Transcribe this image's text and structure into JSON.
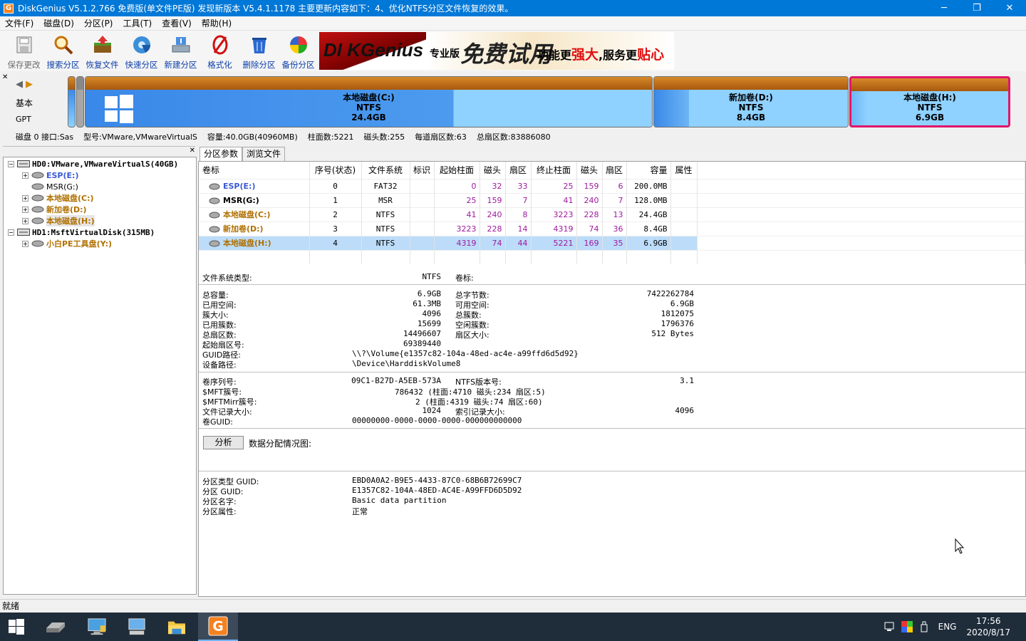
{
  "window": {
    "title": "DiskGenius V5.1.2.766 免费版(单文件PE版)   发现新版本 V5.4.1.1178 主要更新内容如下：4、优化NTFS分区文件恢复的效果。",
    "app_icon": "G",
    "min": "─",
    "max": "❐",
    "close": "✕"
  },
  "menu": [
    "文件(F)",
    "磁盘(D)",
    "分区(P)",
    "工具(T)",
    "查看(V)",
    "帮助(H)"
  ],
  "toolbar": [
    {
      "label": "保存更改",
      "icon": "save-icon",
      "disabled": true
    },
    {
      "label": "搜索分区",
      "icon": "search-icon"
    },
    {
      "label": "恢复文件",
      "icon": "recover-icon"
    },
    {
      "label": "快速分区",
      "icon": "quick-partition-icon"
    },
    {
      "label": "新建分区",
      "icon": "new-partition-icon"
    },
    {
      "label": "格式化",
      "icon": "format-icon"
    },
    {
      "label": "删除分区",
      "icon": "delete-icon"
    },
    {
      "label": "备份分区",
      "icon": "backup-icon"
    }
  ],
  "banner": {
    "brand": "DI KGenius",
    "edition": "专业版",
    "free": "免费试用",
    "slogan1": "功能更",
    "slogan2": "强大",
    "slogan3": ",服务更",
    "slogan4": "贴心"
  },
  "disk_nav": {
    "type1": "基本",
    "type2": "GPT"
  },
  "disk_segments": [
    {
      "name": "本地磁盘(C:)",
      "fs": "NTFS",
      "size": "24.4GB"
    },
    {
      "name": "新加卷(D:)",
      "fs": "NTFS",
      "size": "8.4GB"
    },
    {
      "name": "本地磁盘(H:)",
      "fs": "NTFS",
      "size": "6.9GB"
    }
  ],
  "disk_info": [
    "磁盘 0 接口:Sas",
    "型号:VMware,VMwareVirtualS",
    "容量:40.0GB(40960MB)",
    "柱面数:5221",
    "磁头数:255",
    "每道扇区数:63",
    "总扇区数:83886080"
  ],
  "tree": {
    "disk0": "HD0:VMware,VMwareVirtualS(40GB)",
    "disk0_parts": [
      "ESP(E:)",
      "MSR(G:)",
      "本地磁盘(C:)",
      "新加卷(D:)",
      "本地磁盘(H:)"
    ],
    "disk1": "HD1:MsftVirtualDisk(315MB)",
    "disk1_parts": [
      "小白PE工具盘(Y:)"
    ]
  },
  "tabs": [
    "分区参数",
    "浏览文件"
  ],
  "table": {
    "headers": [
      "卷标",
      "序号(状态)",
      "文件系统",
      "标识",
      "起始柱面",
      "磁头",
      "扇区",
      "终止柱面",
      "磁头",
      "扇区",
      "容量",
      "属性"
    ],
    "rows": [
      [
        "ESP(E:)",
        "0",
        "FAT32",
        "",
        "0",
        "32",
        "33",
        "25",
        "159",
        "6",
        "200.0MB",
        ""
      ],
      [
        "MSR(G:)",
        "1",
        "MSR",
        "",
        "25",
        "159",
        "7",
        "41",
        "240",
        "7",
        "128.0MB",
        ""
      ],
      [
        "本地磁盘(C:)",
        "2",
        "NTFS",
        "",
        "41",
        "240",
        "8",
        "3223",
        "228",
        "13",
        "24.4GB",
        ""
      ],
      [
        "新加卷(D:)",
        "3",
        "NTFS",
        "",
        "3223",
        "228",
        "14",
        "4319",
        "74",
        "36",
        "8.4GB",
        ""
      ],
      [
        "本地磁盘(H:)",
        "4",
        "NTFS",
        "",
        "4319",
        "74",
        "44",
        "5221",
        "169",
        "35",
        "6.9GB",
        ""
      ]
    ]
  },
  "fs_info": {
    "fs_type_label": "文件系统类型:",
    "fs_type": "NTFS",
    "vol_label_label": "卷标:",
    "left": [
      [
        "总容量:",
        "6.9GB"
      ],
      [
        "已用空间:",
        "61.3MB"
      ],
      [
        "簇大小:",
        "4096"
      ],
      [
        "已用簇数:",
        "15699"
      ],
      [
        "总扇区数:",
        "14496607"
      ],
      [
        "起始扇区号:",
        "69389440"
      ]
    ],
    "right": [
      [
        "总字节数:",
        "7422262784"
      ],
      [
        "可用空间:",
        "6.9GB"
      ],
      [
        "总簇数:",
        "1812075"
      ],
      [
        "空闲簇数:",
        "1796376"
      ],
      [
        "扇区大小:",
        "512 Bytes"
      ]
    ],
    "guid_path_label": "GUID路径:",
    "guid_path": "\\\\?\\Volume{e1357c82-104a-48ed-ac4e-a99ffd6d5d92}",
    "device_path_label": "设备路径:",
    "device_path": "\\Device\\HarddiskVolume8",
    "serial_label": "卷序列号:",
    "serial": "09C1-B27D-A5EB-573A",
    "ntfs_ver_label": "NTFS版本号:",
    "ntfs_ver": "3.1",
    "mft_label": "$MFT簇号:",
    "mft": "786432 (柱面:4710 磁头:234 扇区:5)",
    "mftmirr_label": "$MFTMirr簇号:",
    "mftmirr": "2 (柱面:4319 磁头:74 扇区:60)",
    "rec_size_label": "文件记录大小:",
    "rec_size": "1024",
    "idx_size_label": "索引记录大小:",
    "idx_size": "4096",
    "vol_guid_label": "卷GUID:",
    "vol_guid": "00000000-0000-0000-0000-000000000000"
  },
  "analyze": {
    "button": "分析",
    "label": "数据分配情况图:"
  },
  "guid_info": [
    [
      "分区类型 GUID:",
      "EBD0A0A2-B9E5-4433-87C0-68B6B72699C7"
    ],
    [
      "分区 GUID:",
      "E1357C82-104A-48ED-AC4E-A99FFD6D5D92"
    ],
    [
      "分区名字:",
      "Basic data partition"
    ],
    [
      "分区属性:",
      "正常"
    ]
  ],
  "status": "就绪",
  "tray": {
    "lang": "ENG",
    "time": "17:56",
    "date": "2020/8/17"
  }
}
